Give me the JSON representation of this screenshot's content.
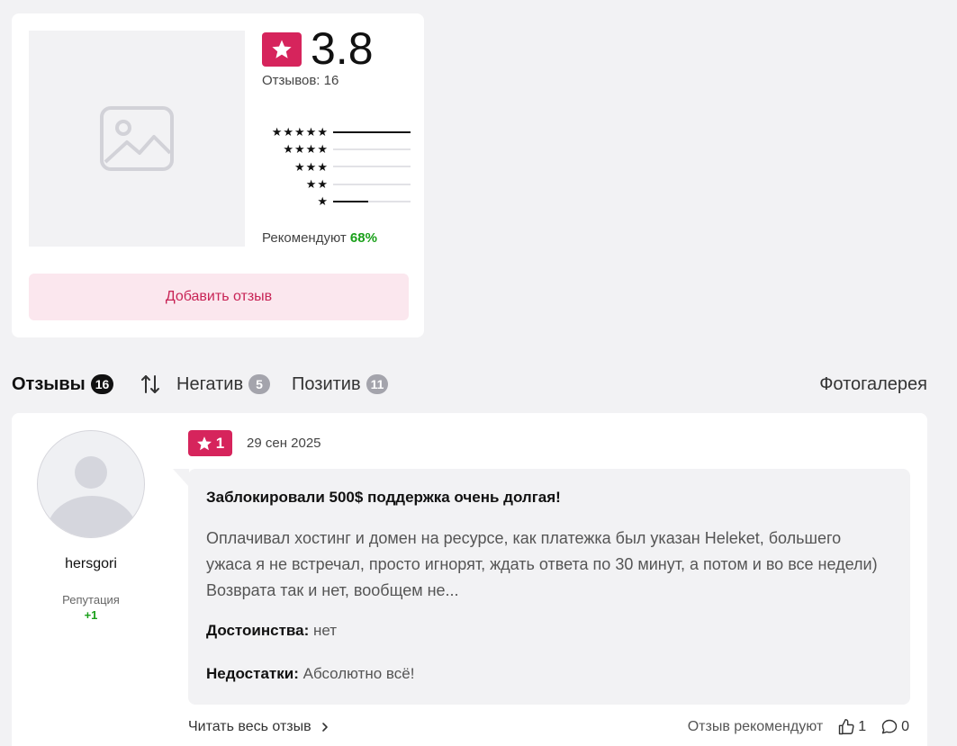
{
  "summary": {
    "rating_value": "3.8",
    "reviews_count": "Отзывов: 16",
    "distribution": [
      {
        "stars": "★★★★★",
        "fraction": 1.0
      },
      {
        "stars": "★★★★",
        "fraction": 0.0
      },
      {
        "stars": "★★★",
        "fraction": 0.0
      },
      {
        "stars": "★★",
        "fraction": 0.0
      },
      {
        "stars": "★",
        "fraction": 0.45
      }
    ],
    "recommend_label": "Рекомендуют",
    "recommend_pct": "68%",
    "add_review_label": "Добавить отзыв"
  },
  "tabs": {
    "reviews": {
      "label": "Отзывы",
      "count": "16"
    },
    "negative": {
      "label": "Негатив",
      "count": "5"
    },
    "positive": {
      "label": "Позитив",
      "count": "11"
    },
    "gallery": "Фотогалерея"
  },
  "review": {
    "author": "hersgori",
    "reputation_label": "Репутация",
    "reputation_value": "+1",
    "rating": "1",
    "date": "29 сен 2025",
    "title": "Заблокировали 500$ поддержка очень долгая!",
    "text": "Оплачивал хостинг и домен на ресурсе, как платежка был указан Heleket, большего ужаса я не встречал, просто игнорят, ждать ответа по 30 минут, а потом и во все недели) Возврата так и нет, вообщем не...",
    "pros_label": "Достоинства:",
    "pros_value": "нет",
    "cons_label": "Недостатки:",
    "cons_value": "Абсолютно всё!",
    "read_more": "Читать весь отзыв",
    "recommend_label": "Отзыв рекомендуют",
    "likes": "1",
    "comments": "0"
  },
  "colors": {
    "accent": "#d6245c",
    "positive": "#1aa01a",
    "background": "#f2f2f4"
  },
  "icons": [
    "image-placeholder-icon",
    "star-icon",
    "sort-icon",
    "chevron-right-icon",
    "thumbs-up-icon",
    "comment-icon"
  ]
}
